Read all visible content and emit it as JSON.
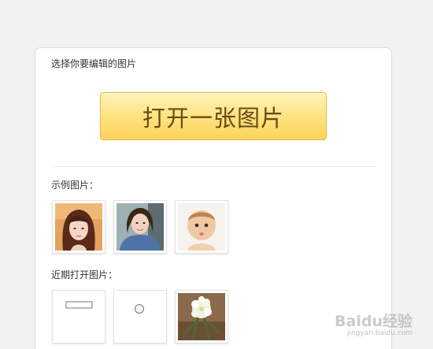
{
  "editor": {
    "prompt": "选择你要编辑的图片",
    "open_button_label": "打开一张图片"
  },
  "examples": {
    "label": "示例图片：",
    "images": [
      "photo-woman-bangs",
      "photo-woman-denim",
      "photo-baby"
    ]
  },
  "recent": {
    "label": "近期打开图片：",
    "images": [
      "blank-rectangle-sketch",
      "blank-circle-sketch",
      "photo-white-flowers"
    ]
  },
  "watermark": {
    "brand": "Baidu经验",
    "url": "jingyan.baidu.com"
  },
  "colors": {
    "button_top": "#fff3b9",
    "button_bottom": "#fcd25d",
    "button_text": "#6a4a12",
    "page_background": "#f2f2f2"
  }
}
